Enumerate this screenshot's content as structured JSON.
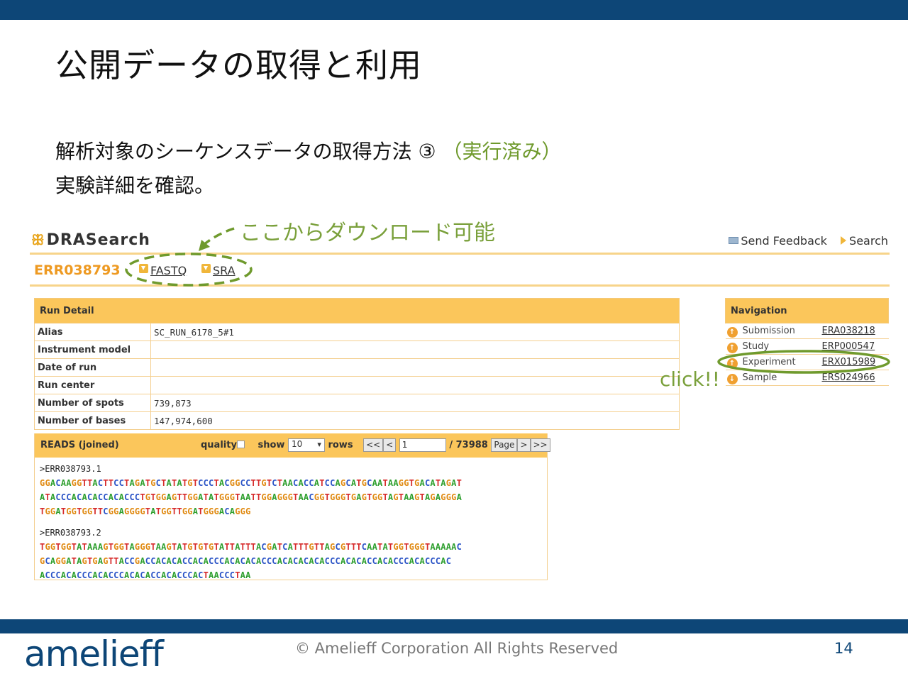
{
  "slide": {
    "title": "公開データの取得と利用",
    "line1_main": "解析対象のシーケンスデータの取得方法 ③ ",
    "line1_note": "（実行済み）",
    "line2": "実験詳細を確認。",
    "callout_download": "ここからダウンロード可能",
    "callout_click": "click!!",
    "accent_color": "#7aa03b"
  },
  "drasearch": {
    "logo": "DRASearch",
    "send_feedback": "Send Feedback",
    "search": "Search",
    "accession": "ERR038793",
    "fastq_label": "FASTQ",
    "sra_label": "SRA"
  },
  "run_detail": {
    "header": "Run Detail",
    "rows": [
      {
        "key": "Alias",
        "value": "SC_RUN_6178_5#1"
      },
      {
        "key": "Instrument model",
        "value": ""
      },
      {
        "key": "Date of run",
        "value": ""
      },
      {
        "key": "Run center",
        "value": ""
      },
      {
        "key": "Number of spots",
        "value": "739,873"
      },
      {
        "key": "Number of bases",
        "value": "147,974,600"
      }
    ]
  },
  "navigation": {
    "header": "Navigation",
    "items": [
      {
        "label": "Submission",
        "link": "ERA038218"
      },
      {
        "label": "Study",
        "link": "ERP000547"
      },
      {
        "label": "Experiment",
        "link": "ERX015989"
      },
      {
        "label": "Sample",
        "link": "ERS024966"
      }
    ]
  },
  "reads": {
    "title": "READS (joined)",
    "quality_label": "quality",
    "show_label": "show",
    "rows_select": "10",
    "rows_label": "rows",
    "first_btn": "<<",
    "prev_btn": "<",
    "page_input": "1",
    "total_pages": "/ 73988",
    "page_btn": "Page",
    "next_btn": ">",
    "last_btn": ">>",
    "entries": [
      {
        "id": ">ERR038793.1",
        "lines": [
          "GGACAAGGTTACTTCCTAGATGCTATATGTCCCTACGGCCTTGTCTAACACCATCCAGCATGCAATAAGGTGACATAGAT",
          "ATACCCACACACCACACCCTGTGGAGTTGGATATGGGTAATTGGAGGGTAACGGTGGGTGAGTGGTAGTAAGTAGAGGGA",
          "TGGATGGTGGTTCGGAGGGGTATGGTTGGATGGGACAGGG"
        ]
      },
      {
        "id": ">ERR038793.2",
        "lines": [
          "TGGTGGTATAAAGTGGTAGGGTAAGTATGTGTGTATTATTTACGATCATTTGTTAGCGTTTCAATATGGTGGGTAAAAAC",
          "GCAGGATAGTGAGTTACCGACCACACACCACACCCACACACACCCACACACACACCCACACACCACACCCACACCCAC",
          "ACCCACACCCACACCCACACACCACACCCACTAACCCTAA"
        ]
      }
    ]
  },
  "footer": {
    "brand": "amelieff",
    "copyright": "© Amelieff Corporation All Rights Reserved",
    "page": "14"
  },
  "colors": {
    "bar": "#0d4677",
    "table_header": "#fbc65b",
    "accession": "#ee9a22"
  }
}
